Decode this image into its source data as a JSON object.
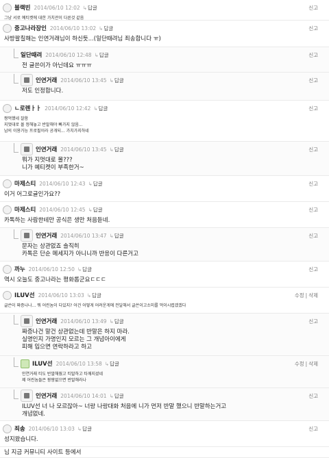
{
  "ui": {
    "reply_label": "답글",
    "reply_arrow": "↳",
    "report_label": "신고",
    "edit_label": "수정",
    "delete_label": "삭제",
    "sep": "|"
  },
  "comments": [
    {
      "author": "블랙빈",
      "date": "2014/06/10 12:02",
      "lines": [
        "그냥 서로 예티켓에 대한 가치관이 다른것 같음"
      ],
      "hand": true
    },
    {
      "author": "중고나라장인",
      "date": "2014/06/10 13:02",
      "lines": [
        "사방팔칠해는 인연거래님이 하신듯...(일단때려님 죄송합니다 ㅠ)"
      ]
    },
    {
      "author": "일단때려",
      "date": "2014/06/10 12:48",
      "lines": [
        "전 글쓴이가 아닌데요 ㅠㅠㅠ"
      ]
    },
    {
      "author": "인연거래",
      "date": "2014/06/10 13:45",
      "lines": [
        "저도 인정합니다."
      ]
    },
    {
      "author": "ㄴ로렌ㅏㅏ",
      "date": "2014/06/10 12:42",
      "lines": [
        "짱먹했네 잘함",
        "지멋대로 몰 정해놓고 반말해야 빠가지 않음...",
        "남의 이용가능 프로필이라 공개되... 가치가지하네"
      ],
      "hand": true
    },
    {
      "author": "인연거래",
      "date": "2014/06/10 13:45",
      "lines": [
        "뭐가 지멋대로 몰???",
        "니가 예티켓이 부족한거~"
      ]
    },
    {
      "author": "마제스티",
      "date": "2014/06/10 12:43",
      "lines": [
        "이거 어그로글인가요??"
      ]
    },
    {
      "author": "마제스티",
      "date": "2014/06/10 12:45",
      "lines": [
        "카톡하는 사람한테만 공식은 생만 처음듣네."
      ]
    },
    {
      "author": "인연거래",
      "date": "2014/06/10 13:47",
      "lines": [
        "문자는 상관없죠 솔직히",
        "카톡은 단순 메세지가 아니니까 반응이 다른거고"
      ]
    },
    {
      "author": "까누",
      "date": "2014/06/10 12:50",
      "lines": [
        "역시 오늘도 중고나라는 평화롭군요ㄷㄷㄷ"
      ]
    },
    {
      "author": "ILUV선",
      "date": "2014/06/10 13:03",
      "lines": [
        "글쓴이 짜증나나... 뭐 어린놈이 다있지? 어건 어떻게 어려운게에 전달해서 글쓴이고소미를 먹이시렵겠겠다"
      ],
      "hand": true
    },
    {
      "author": "인연거래",
      "date": "2014/06/10 13:49",
      "lines": [
        "짜증나건 말건 상관없는데 반말은 하지 마라.",
        "실명인지 가명인지 모르는 그 개념아이에게",
        "피해 입으면 연락하라고 하고"
      ]
    },
    {
      "author": "ILUV선",
      "date": "2014/06/10 13:58",
      "lines": [
        "인연거래 티도 반말해줬고 티말하고 타깨지셨네",
        "제 어린놈들은 팡팡없으면 반말해라나"
      ],
      "hand": true
    },
    {
      "author": "인연거래",
      "date": "2014/06/10 14:01",
      "lines": [
        "ILUV선 너 나 모르잖아~ 너랑 나랑대화 처음에 니가 먼저 반말 했으니 반말하는거고",
        "개념없네."
      ]
    },
    {
      "author": "죄송",
      "date": "2014/06/10 13:03",
      "lines": [
        "성지왔습니다."
      ]
    },
    {
      "author": "",
      "date": "",
      "lines": [
        "님 지금 커뮤니티 사이트 등에서"
      ]
    }
  ]
}
